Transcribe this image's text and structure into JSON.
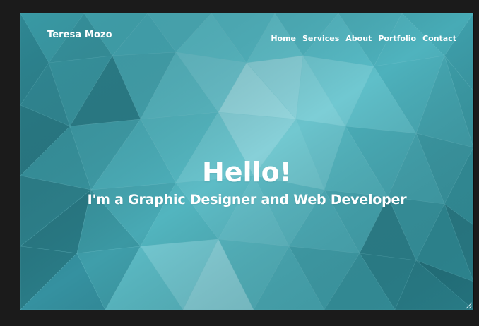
{
  "header": {
    "brand": "Teresa Mozo",
    "nav": [
      {
        "label": "Home"
      },
      {
        "label": "Services"
      },
      {
        "label": "About"
      },
      {
        "label": "Portfolio"
      },
      {
        "label": "Contact"
      }
    ]
  },
  "hero": {
    "title": "Hello!",
    "subtitle": "I'm a Graphic Designer and Web Developer"
  },
  "theme": {
    "background": "#1b1b1b",
    "accent": "#4fb3c0",
    "text": "#ffffff"
  }
}
